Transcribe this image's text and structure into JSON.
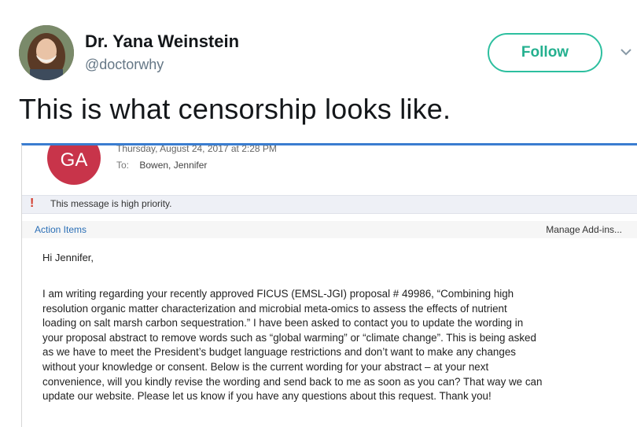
{
  "tweet": {
    "author_name": "Dr. Yana Weinstein",
    "author_handle": "@doctorwhy",
    "follow_label": "Follow",
    "text": "This is what censorship looks like."
  },
  "icons": {
    "avatar": "profile-photo",
    "menu": "chevron-down-icon",
    "priority": "exclamation-icon"
  },
  "colors": {
    "follow": "#24b08f",
    "email_accent": "#3a7dd0",
    "sender_avatar": "#c8344a",
    "priority_icon": "#d23a2a",
    "link": "#2b6fb6"
  },
  "email": {
    "sender_initials": "GA",
    "sent_line": "Thursday, August 24, 2017 at 2:28 PM",
    "to_label": "To:",
    "to_value": "Bowen, Jennifer",
    "priority_icon_glyph": "!",
    "priority_text": "This message is high priority.",
    "action_items_label": "Action Items",
    "manage_addins_label": "Manage Add-ins...",
    "greeting": "Hi Jennifer,",
    "body_lines": [
      "I am writing regarding your recently approved FICUS (EMSL-JGI) proposal # 49986, “Combining high",
      "resolution organic matter characterization and microbial meta-omics to assess the effects of nutrient",
      "loading on salt marsh carbon sequestration.”  I have been asked to contact you to update the wording in",
      "your proposal abstract to remove words such as “global warming” or “climate change”.  This is being asked",
      "as we have to meet the President’s budget language restrictions and don’t want to make any changes",
      "without your knowledge or consent.  Below is the current wording for your abstract – at your next",
      "convenience, will you kindly revise the wording and send back to me as soon as you can?  That way we can",
      "update our website.  Please let us know if you have any questions about this request.  Thank you!"
    ]
  }
}
